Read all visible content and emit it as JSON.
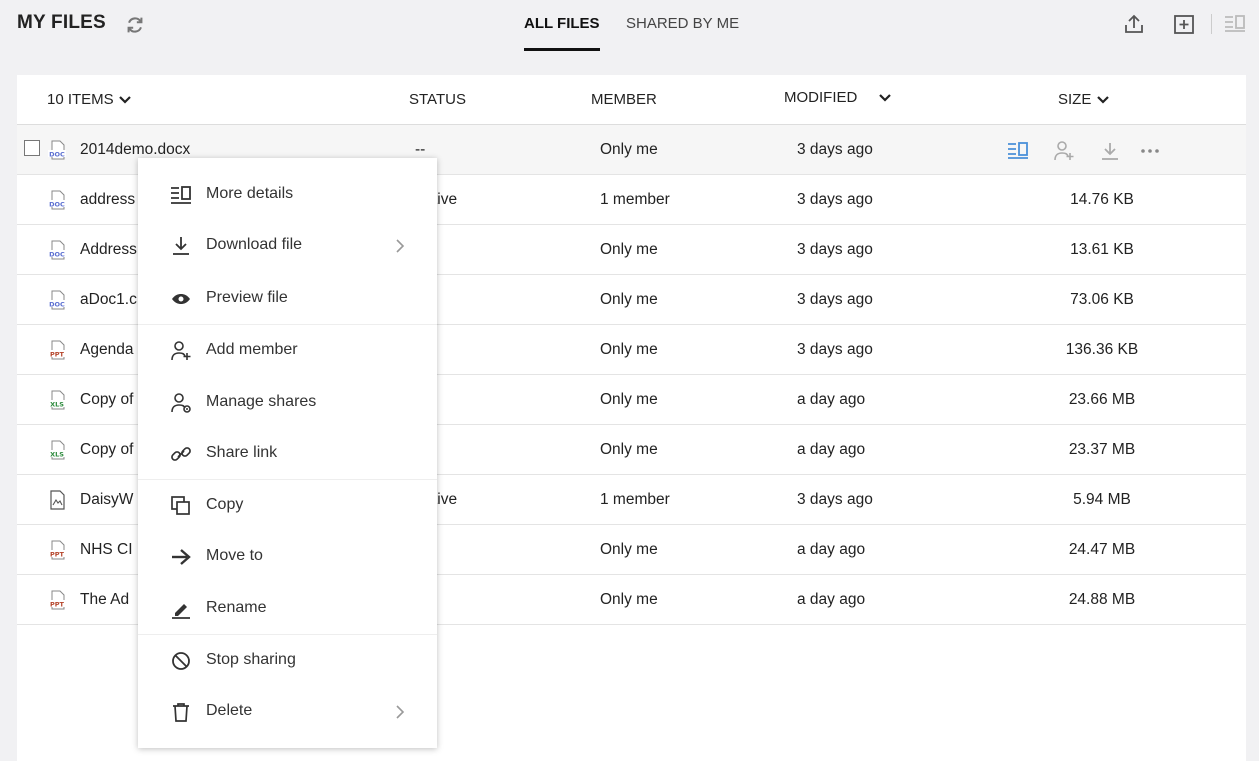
{
  "header": {
    "title": "MY FILES",
    "tabs": [
      {
        "label": "ALL FILES",
        "active": true
      },
      {
        "label": "SHARED BY ME",
        "active": false
      }
    ]
  },
  "table": {
    "item_count": "10 ITEMS",
    "columns": {
      "status": "STATUS",
      "member": "MEMBER",
      "modified": "MODIFIED",
      "size": "SIZE"
    },
    "rows": [
      {
        "name": "2014demo.docx",
        "type": "doc",
        "status": "--",
        "member": "Only me",
        "modified": "3 days ago",
        "size": ""
      },
      {
        "name": "address",
        "type": "doc",
        "status": "tive",
        "member": "1 member",
        "modified": "3 days ago",
        "size": "14.76 KB"
      },
      {
        "name": "Address",
        "type": "doc",
        "status": "",
        "member": "Only me",
        "modified": "3 days ago",
        "size": "13.61 KB"
      },
      {
        "name": "aDoc1.c",
        "type": "doc",
        "status": "",
        "member": "Only me",
        "modified": "3 days ago",
        "size": "73.06 KB"
      },
      {
        "name": "Agenda",
        "type": "ppt",
        "status": "",
        "member": "Only me",
        "modified": "3 days ago",
        "size": "136.36 KB"
      },
      {
        "name": "Copy of",
        "type": "xls",
        "status": "",
        "member": "Only me",
        "modified": "a day ago",
        "size": "23.66 MB"
      },
      {
        "name": "Copy of",
        "type": "xls",
        "status": "",
        "member": "Only me",
        "modified": "a day ago",
        "size": "23.37 MB"
      },
      {
        "name": "DaisyW",
        "type": "img",
        "status": "tive",
        "member": "1 member",
        "modified": "3 days ago",
        "size": "5.94 MB"
      },
      {
        "name": "NHS CI",
        "type": "ppt",
        "status": "",
        "member": "Only me",
        "modified": "a day ago",
        "size": "24.47 MB"
      },
      {
        "name": "The Ad",
        "type": "ppt",
        "status": "",
        "member": "Only me",
        "modified": "a day ago",
        "size": "24.88 MB"
      }
    ]
  },
  "icon_labels": {
    "doc": "DOC",
    "ppt": "PPT",
    "xls": "XLS"
  },
  "menu": {
    "items": [
      {
        "label": "More details",
        "icon": "details-icon"
      },
      {
        "label": "Download file",
        "icon": "download-icon",
        "submenu": true
      },
      {
        "label": "Preview file",
        "icon": "eye-icon"
      },
      {
        "label": "Add member",
        "icon": "add-member-icon"
      },
      {
        "label": "Manage shares",
        "icon": "manage-shares-icon"
      },
      {
        "label": "Share link",
        "icon": "link-icon"
      },
      {
        "label": "Copy",
        "icon": "copy-icon"
      },
      {
        "label": "Move to",
        "icon": "arrow-right-icon"
      },
      {
        "label": "Rename",
        "icon": "pencil-icon"
      },
      {
        "label": "Stop sharing",
        "icon": "stop-icon"
      },
      {
        "label": "Delete",
        "icon": "trash-icon",
        "submenu": true
      }
    ]
  },
  "colors": {
    "accent": "#4a90d9",
    "doc": "#5b6fd1",
    "ppt": "#b5442a",
    "xls": "#2e8b3e"
  }
}
